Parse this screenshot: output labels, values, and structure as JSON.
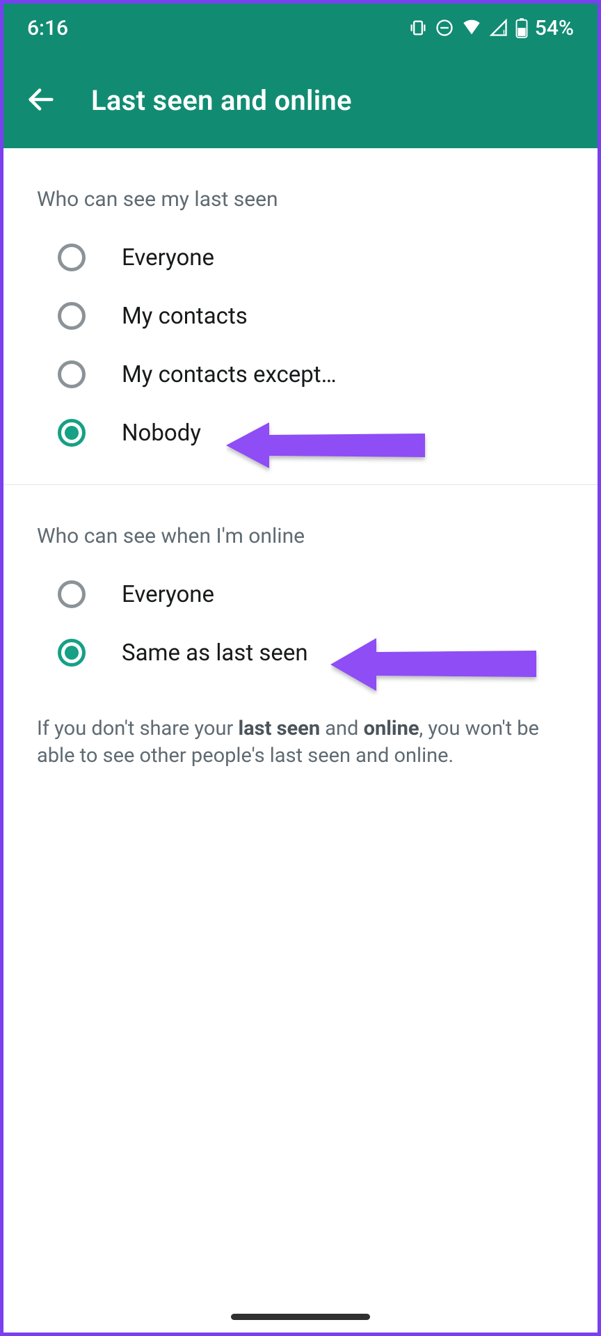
{
  "status": {
    "time": "6:16",
    "battery_percent": "54%"
  },
  "appbar": {
    "title": "Last seen and online"
  },
  "section1": {
    "title": "Who can see my last seen",
    "options": {
      "0": {
        "label": "Everyone",
        "selected": false
      },
      "1": {
        "label": "My contacts",
        "selected": false
      },
      "2": {
        "label": "My contacts except…",
        "selected": false
      },
      "3": {
        "label": "Nobody",
        "selected": true
      }
    }
  },
  "section2": {
    "title": "Who can see when I'm online",
    "options": {
      "0": {
        "label": "Everyone",
        "selected": false
      },
      "1": {
        "label": "Same as last seen",
        "selected": true
      }
    }
  },
  "help": {
    "pre": "If you don't share your ",
    "b1": "last seen",
    "mid": " and ",
    "b2": "online",
    "post": ", you won't be able to see other people's last seen and online."
  }
}
